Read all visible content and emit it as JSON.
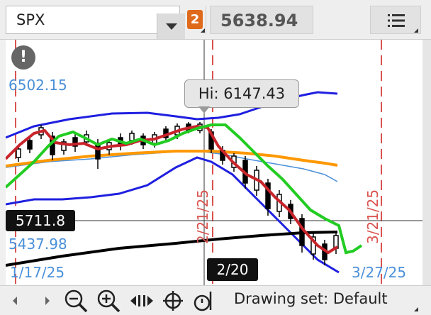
{
  "toolbar": {
    "symbol": "SPX",
    "badge": "2",
    "price": "5638.94",
    "icons": {
      "dropdown": "chevron-down-icon",
      "menu": "menu-list-icon"
    },
    "colors": {
      "badge": "#e06a1b"
    }
  },
  "chart": {
    "alert_icon_glyph": "!",
    "price_labels": {
      "top": "6502.15",
      "bottom": "5437.98"
    },
    "cursor_price": "5711.8",
    "cursor_date": "2/20",
    "hi_tooltip": "Hi: 6147.43",
    "date_labels": {
      "start": "1/17/25",
      "end": "3/27/25"
    },
    "vertical_dates": {
      "a": "2/21/25",
      "b": "3/21/25"
    },
    "colors": {
      "candles": "#000000",
      "price_line": "#c8242b",
      "green_line": "#22cc22",
      "orange_ma": "#ff9800",
      "black_ma": "#000000",
      "bollinger": "#1f1fe0",
      "blue_thin": "#4a90d9",
      "vertical_markers": "#d9534f",
      "labels": "#4a90d9"
    }
  },
  "bottom_bar": {
    "drawing_set": "Drawing set: Default",
    "icons": [
      "scroll-left-icon",
      "scroll-right-icon",
      "zoom-out-icon",
      "zoom-in-icon",
      "pan-arrows-icon",
      "crosshair-icon",
      "timer-icon"
    ]
  }
}
